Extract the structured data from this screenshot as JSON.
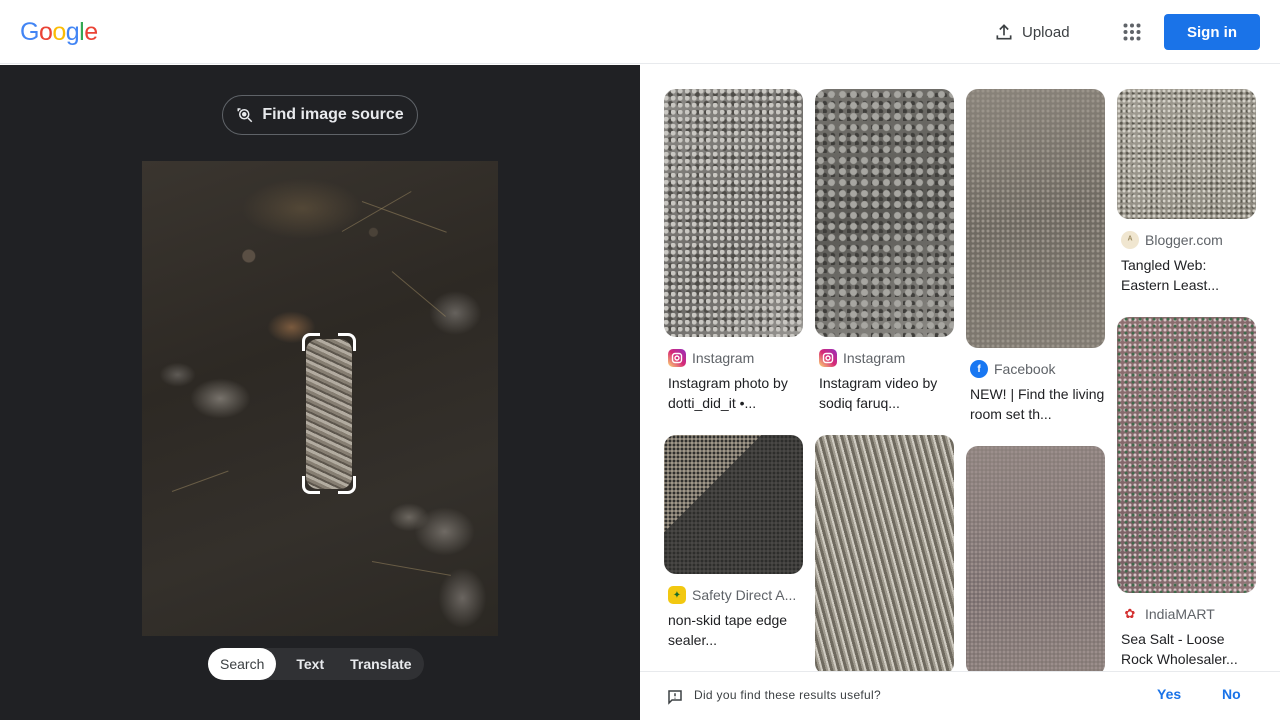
{
  "header": {
    "logo_letters": [
      "G",
      "o",
      "o",
      "g",
      "l",
      "e"
    ],
    "logo_colors": [
      "#4285f4",
      "#ea4335",
      "#fbbc05",
      "#4285f4",
      "#34a853",
      "#ea4335"
    ],
    "upload_label": "Upload",
    "signin_label": "Sign in",
    "apps_icon": "apps-grid-icon",
    "upload_icon": "upload-icon"
  },
  "left": {
    "find_source_label": "Find image source",
    "find_source_icon": "lens-search-icon",
    "tabs": [
      {
        "label": "Search",
        "active": true
      },
      {
        "label": "Text",
        "active": false
      },
      {
        "label": "Translate",
        "active": false
      }
    ]
  },
  "results": [
    {
      "source": "Instagram",
      "title": "Instagram photo by dotti_did_it •...",
      "favicon": "instagram-icon",
      "favicon_color": "#d6249f"
    },
    {
      "source": "Instagram",
      "title": "Instagram video by sodiq faruq...",
      "favicon": "instagram-icon",
      "favicon_color": "#d6249f"
    },
    {
      "source": "Facebook",
      "title": "NEW! | Find the living room set th...",
      "favicon": "facebook-icon",
      "favicon_color": "#1877f2"
    },
    {
      "source": "Blogger.com",
      "title": "Tangled Web: Eastern Least...",
      "favicon": "blogger-icon",
      "favicon_color": "#f0e6d0"
    },
    {
      "source": "Safety Direct A...",
      "title": "non-skid tape edge sealer...",
      "favicon": "safety-direct-icon",
      "favicon_color": "#f2c811"
    },
    {
      "source": "",
      "title": "",
      "favicon": "",
      "favicon_color": ""
    },
    {
      "source": "",
      "title": "",
      "favicon": "",
      "favicon_color": ""
    },
    {
      "source": "IndiaMART",
      "title": "Sea Salt - Loose Rock Wholesaler...",
      "favicon": "indiamart-icon",
      "favicon_color": "#d32f2f"
    }
  ],
  "feedback": {
    "question": "Did you find these results useful?",
    "yes_label": "Yes",
    "no_label": "No",
    "icon": "feedback-icon"
  }
}
